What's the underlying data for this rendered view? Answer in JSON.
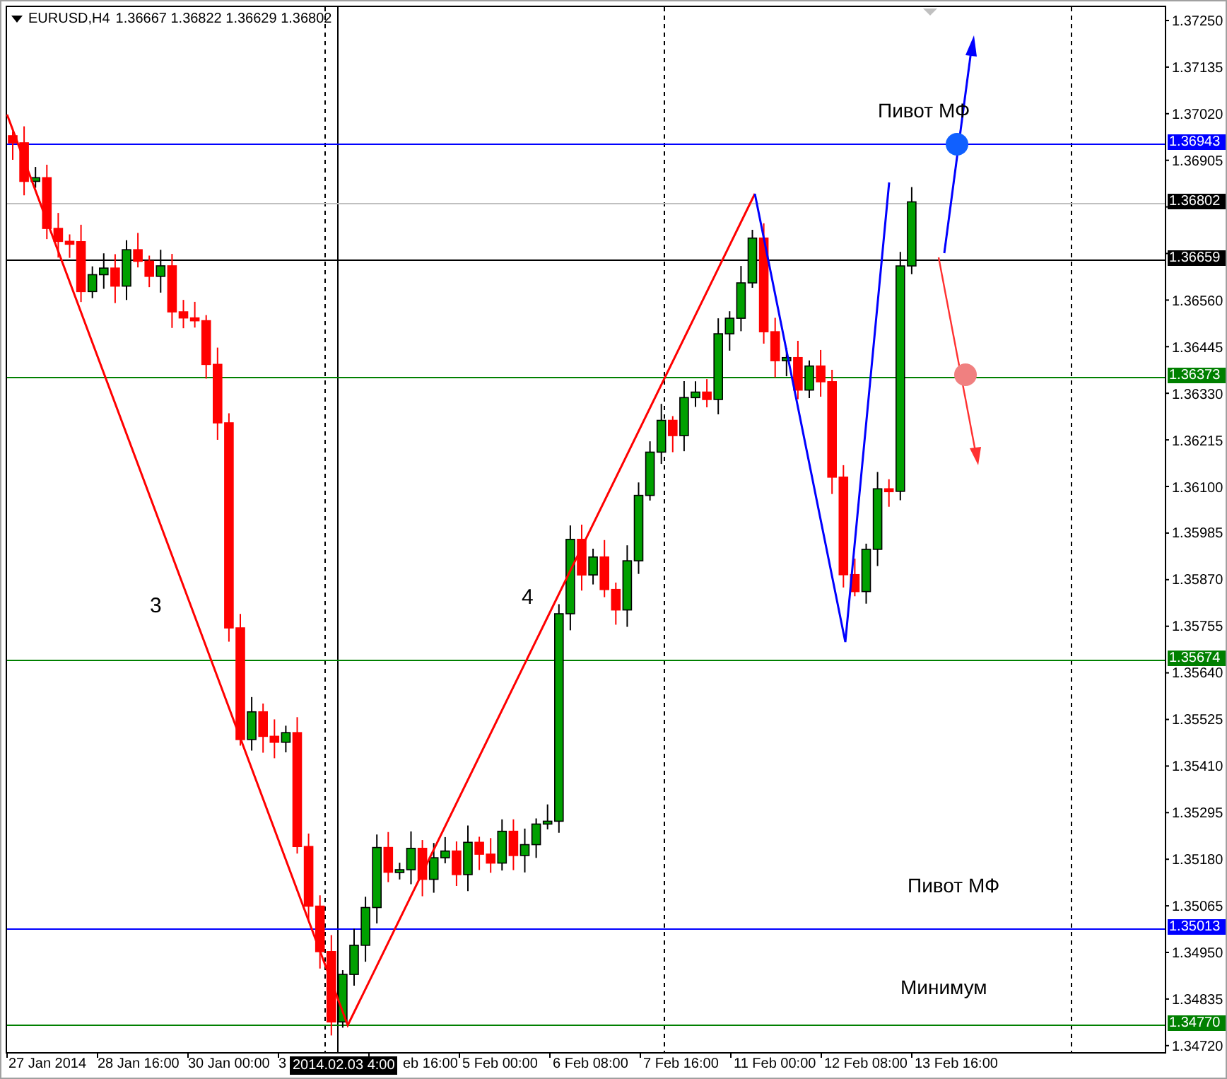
{
  "header": {
    "symbol": "EURUSD,H4",
    "ohlc": "1.36667 1.36822 1.36629 1.36802"
  },
  "price_ticks": [
    "1.37250",
    "1.37135",
    "1.37020",
    "1.36905",
    "1.36560",
    "1.36445",
    "1.36330",
    "1.36215",
    "1.36100",
    "1.35985",
    "1.35870",
    "1.35755",
    "1.35640",
    "1.35525",
    "1.35410",
    "1.35295",
    "1.35180",
    "1.35065",
    "1.34950",
    "1.34835",
    "1.34720"
  ],
  "price_lines": [
    {
      "price": "1.36943",
      "color": "#0000ff",
      "kind": "level"
    },
    {
      "price": "1.36802",
      "color": "#000000",
      "kind": "bid"
    },
    {
      "price": "1.36659",
      "color": "#000000",
      "kind": "level"
    },
    {
      "price": "1.36373",
      "color": "#008000",
      "kind": "level"
    },
    {
      "price": "1.35674",
      "color": "#008000",
      "kind": "level"
    },
    {
      "price": "1.35013",
      "color": "#0000ff",
      "kind": "level"
    },
    {
      "price": "1.34770",
      "color": "#008000",
      "kind": "level"
    }
  ],
  "time_labels": [
    "27 Jan 2014",
    "28 Jan 16:00",
    "30 Jan 00:00",
    "3",
    "eb 16:00",
    "5 Feb 00:00",
    "6 Feb 08:00",
    "7 Feb 16:00",
    "11 Feb 00:00",
    "12 Feb 08:00",
    "13 Feb 16:00"
  ],
  "crosshair_time": "2014.02.03 4:00",
  "wave_labels": [
    "3",
    "4"
  ],
  "annotations": [
    "Пивот МФ",
    "Пивот МФ",
    "Минимум"
  ]
}
